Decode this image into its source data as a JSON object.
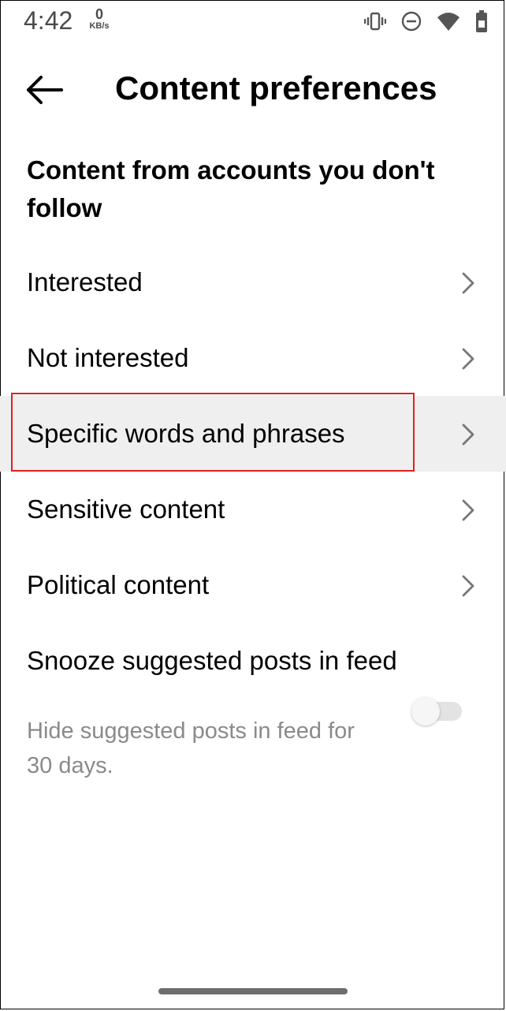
{
  "status_bar": {
    "time": "4:42",
    "net_speed_value": "0",
    "net_speed_unit": "KB/s",
    "icons": [
      "vibrate-icon",
      "do-not-disturb-icon",
      "wifi-icon",
      "battery-icon"
    ]
  },
  "app_bar": {
    "title": "Content preferences",
    "back_icon": "arrow-left-icon"
  },
  "section": {
    "heading": "Content from accounts you don't follow"
  },
  "menu": {
    "items": [
      {
        "label": "Interested"
      },
      {
        "label": "Not interested"
      },
      {
        "label": "Specific words and phrases",
        "highlighted": true
      },
      {
        "label": "Sensitive content"
      },
      {
        "label": "Political content"
      }
    ]
  },
  "snooze": {
    "title": "Snooze suggested posts in feed",
    "description": "Hide suggested posts in feed for 30 days.",
    "enabled": false
  },
  "colors": {
    "highlight_row": "#efefef",
    "annotation_box": "#e02020",
    "secondary_text": "#8a8a8a"
  }
}
